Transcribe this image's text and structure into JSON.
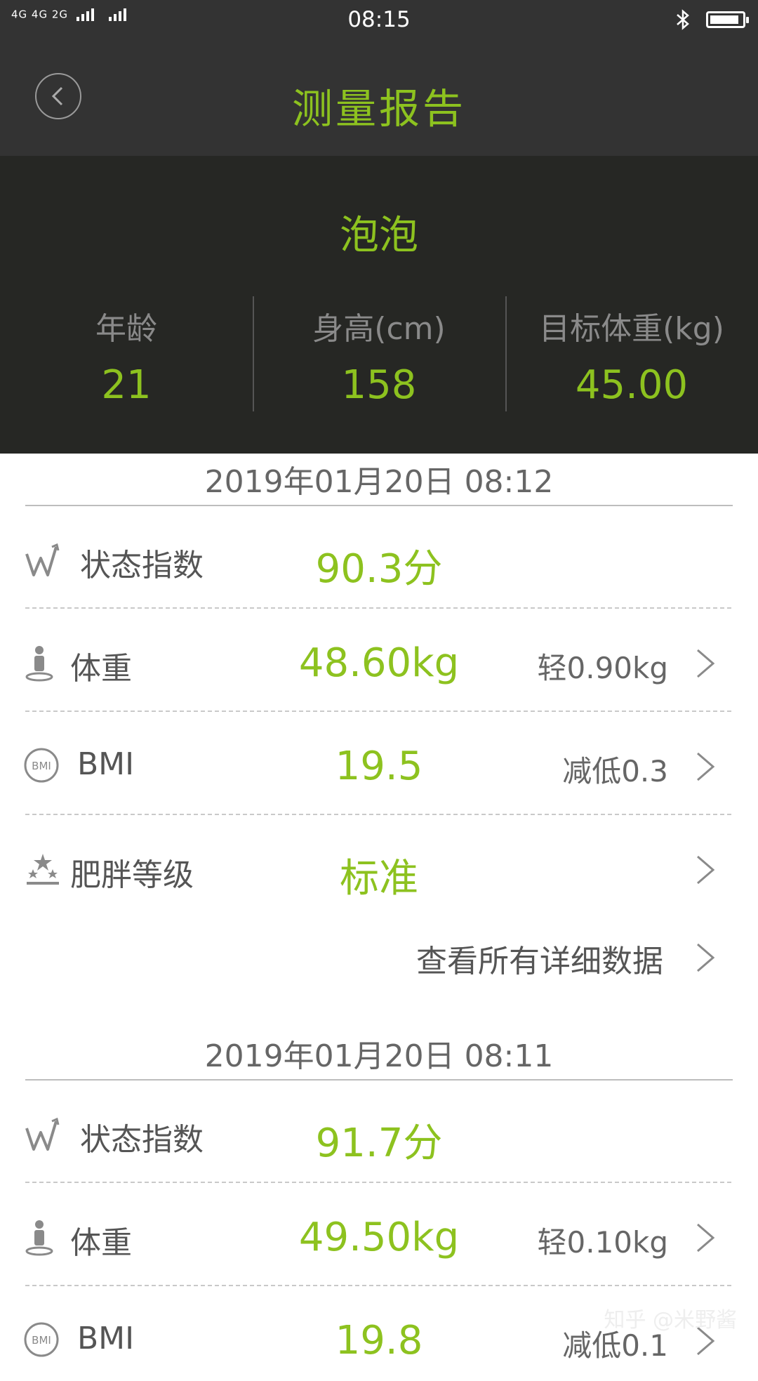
{
  "status_bar": {
    "signal_text": "4G 4G 2G",
    "time": "08:15",
    "icons": [
      "signal-icon",
      "bluetooth-icon",
      "battery-icon"
    ],
    "battery_level": 0.92
  },
  "nav": {
    "title": "测量报告",
    "back_icon": "chevron-left-icon"
  },
  "profile": {
    "name": "泡泡",
    "stats": [
      {
        "label": "年龄",
        "value": "21"
      },
      {
        "label": "身高(cm)",
        "value": "158"
      },
      {
        "label": "目标体重(kg)",
        "value": "45.00"
      }
    ]
  },
  "reports": [
    {
      "date": "2019年01月20日 08:12",
      "rows": [
        {
          "icon": "trend-icon",
          "label": "状态指数",
          "value": "90.3分",
          "note": ""
        },
        {
          "icon": "person-weight-icon",
          "label": "体重",
          "value": "48.60kg",
          "note": "轻0.90kg"
        },
        {
          "icon": "bmi-icon",
          "label": "BMI",
          "value": "19.5",
          "note": "减低0.3"
        },
        {
          "icon": "stars-icon",
          "label": "肥胖等级",
          "value": "标准",
          "note": ""
        }
      ],
      "details_link": "查看所有详细数据"
    },
    {
      "date": "2019年01月20日 08:11",
      "rows": [
        {
          "icon": "trend-icon",
          "label": "状态指数",
          "value": "91.7分",
          "note": ""
        },
        {
          "icon": "person-weight-icon",
          "label": "体重",
          "value": "49.50kg",
          "note": "轻0.10kg"
        },
        {
          "icon": "bmi-icon",
          "label": "BMI",
          "value": "19.8",
          "note": "减低0.1"
        }
      ]
    }
  ],
  "watermark": "知乎 @米野酱",
  "colors": {
    "accent": "#8dc21f",
    "header_bg": "#333333",
    "profile_bg": "#262724",
    "text_gray": "#555555"
  }
}
